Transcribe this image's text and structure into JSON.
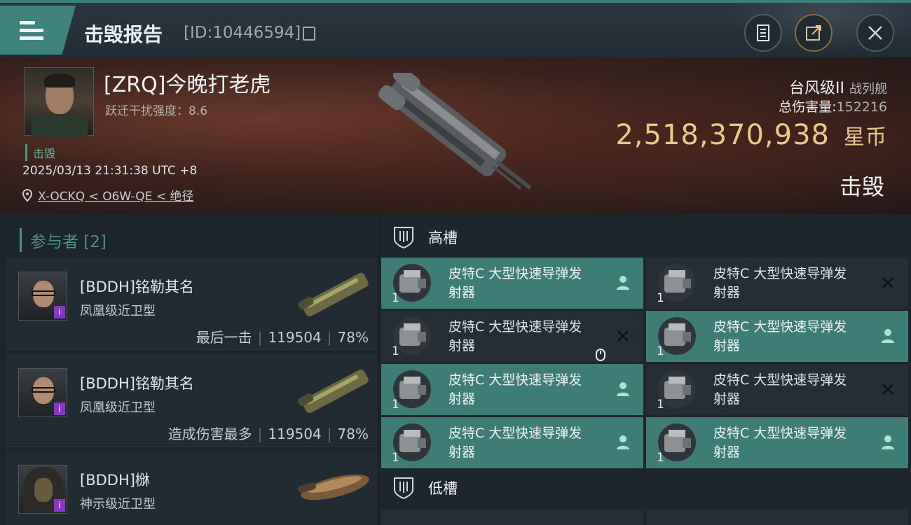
{
  "header": {
    "title": "击毁报告",
    "report_id": "[ID:10446594]"
  },
  "victim": {
    "name": "[ZRQ]今晚打老虎",
    "disruption": "跃迁干扰强度：8.6",
    "status": "击毁",
    "timestamp": "2025/03/13 21:31:38 UTC +8",
    "location": "X-OCKQ < O6W-QE < 绝径",
    "ship_class": "台风级II",
    "ship_category": "战列舰",
    "total_damage_label": "总伤害量:",
    "total_damage": "152216",
    "isk_value": "2,518,370,938",
    "isk_unit": "星币",
    "result": "击毁"
  },
  "participants": {
    "header": "参与者 [2]",
    "items": [
      {
        "name": "[BDDH]铭勒其名",
        "ship": "凤凰级近卫型",
        "role": "最后一击",
        "damage": "119504",
        "percent": "78%"
      },
      {
        "name": "[BDDH]铭勒其名",
        "ship": "凤凰级近卫型",
        "role": "造成伤害最多",
        "damage": "119504",
        "percent": "78%"
      },
      {
        "name": "[BDDH]椕",
        "ship": "神示级近卫型"
      }
    ]
  },
  "slots": {
    "high_label": "高槽",
    "low_label": "低槽",
    "modules": [
      {
        "line1": "皮特C 大型快速导弹发",
        "line2": "射器",
        "qty": "1",
        "state": "fitted"
      },
      {
        "line1": "皮特C 大型快速导弹发",
        "line2": "射器",
        "qty": "1",
        "state": "destroyed"
      },
      {
        "line1": "皮特C 大型快速导弹发",
        "line2": "射器",
        "qty": "1",
        "state": "destroyed"
      },
      {
        "line1": "皮特C 大型快速导弹发",
        "line2": "射器",
        "qty": "1",
        "state": "fitted"
      },
      {
        "line1": "皮特C 大型快速导弹发",
        "line2": "射器",
        "qty": "1",
        "state": "fitted"
      },
      {
        "line1": "皮特C 大型快速导弹发",
        "line2": "射器",
        "qty": "1",
        "state": "destroyed"
      },
      {
        "line1": "皮特C 大型快速导弹发",
        "line2": "射器",
        "qty": "1",
        "state": "fitted"
      },
      {
        "line1": "皮特C 大型快速导弹发",
        "line2": "射器",
        "qty": "1",
        "state": "fitted"
      }
    ]
  },
  "colors": {
    "accent": "#3e7c76",
    "isk": "#e8c98b",
    "badge": "#8a35c9"
  },
  "icons": [
    "menu-icon",
    "copy-icon",
    "notes-icon",
    "share-icon",
    "close-icon",
    "location-pin-icon",
    "high-slot-icon",
    "low-slot-icon",
    "pilot-icon",
    "destroyed-x-icon"
  ]
}
